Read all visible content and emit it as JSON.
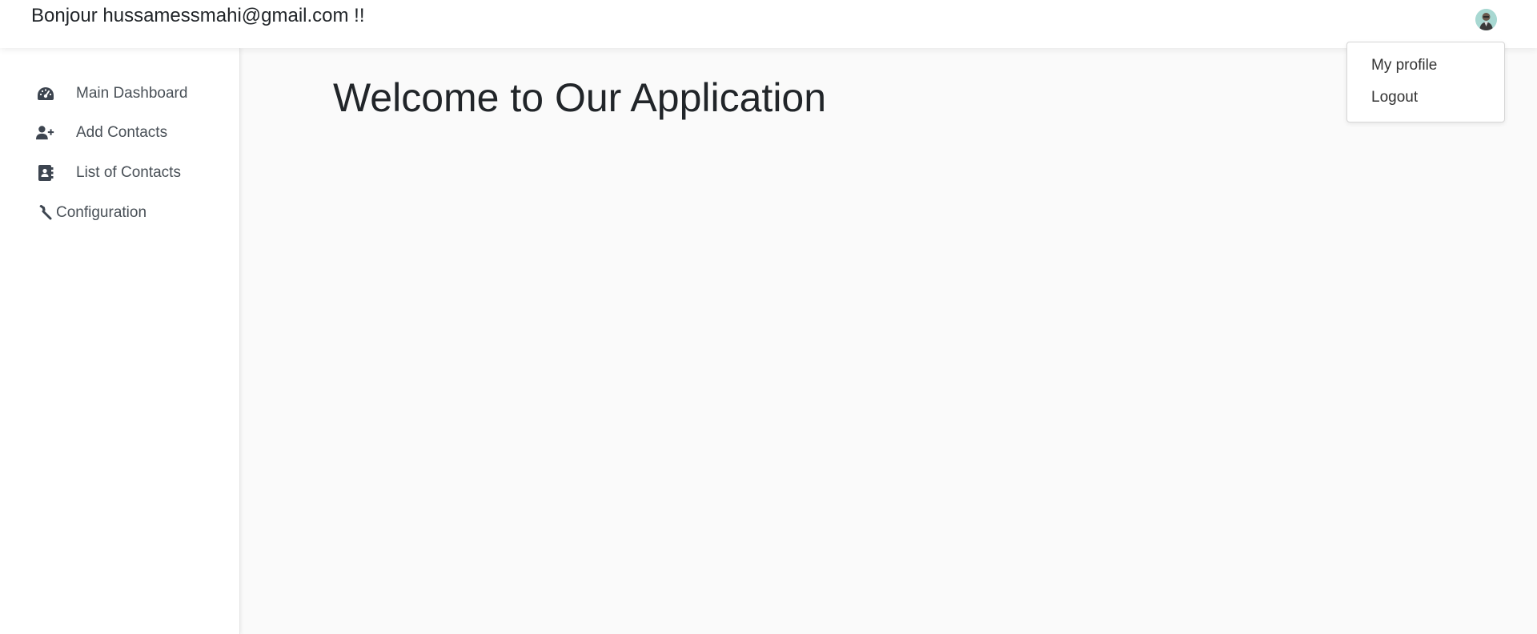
{
  "header": {
    "greeting": "Bonjour hussamessmahi@gmail.com !!"
  },
  "profile_menu": {
    "items": [
      {
        "label": "My profile"
      },
      {
        "label": "Logout"
      }
    ]
  },
  "sidebar": {
    "items": [
      {
        "label": "Main Dashboard",
        "icon": "gauge-icon"
      },
      {
        "label": "Add Contacts",
        "icon": "user-plus-icon"
      },
      {
        "label": "List of Contacts",
        "icon": "address-book-icon"
      },
      {
        "label": "Configuration",
        "icon": "hammer-icon"
      }
    ]
  },
  "main": {
    "title": "Welcome to Our Application"
  },
  "colors": {
    "sidebar_icon": "#3d4550",
    "background": "#fafafa",
    "text": "#212529"
  }
}
